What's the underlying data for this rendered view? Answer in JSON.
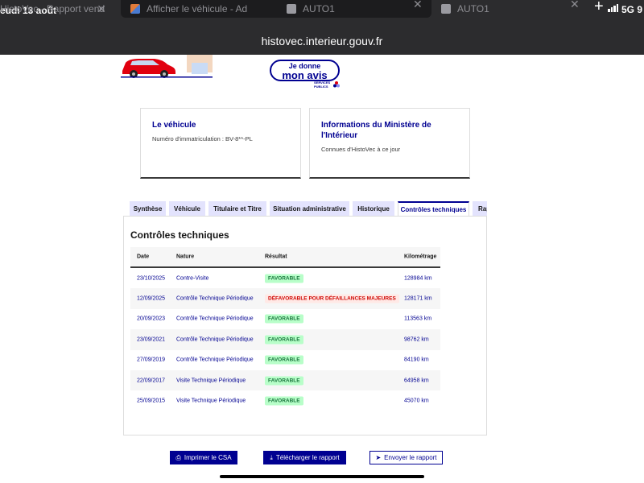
{
  "status_bar": {
    "date": "eudi 13 août",
    "network": "5G 9"
  },
  "browser": {
    "tabs": [
      {
        "title": "HistoVec - Rapport vend"
      },
      {
        "title": "Afficher le véhicule - Ad"
      },
      {
        "title": "AUTO1"
      },
      {
        "title": "AUTO1"
      }
    ],
    "url": "histovec.interieur.gouv.fr"
  },
  "header": {
    "opinion_line1": "Je donne",
    "opinion_line2": "mon avis",
    "services_line1": "SERVICES",
    "services_line2": "PUBLICS"
  },
  "cards": [
    {
      "title": "Le véhicule",
      "text": "Numéro d'immatriculation : BV-8**-PL"
    },
    {
      "title": "Informations du Ministère de l'Intérieur",
      "text": "Connues d'HistoVec à ce jour"
    }
  ],
  "tabs": [
    {
      "label": "Synthèse"
    },
    {
      "label": "Véhicule"
    },
    {
      "label": "Titulaire et Titre"
    },
    {
      "label": "Situation administrative"
    },
    {
      "label": "Historique"
    },
    {
      "label": "Contrôles techniques"
    },
    {
      "label": "Rap"
    }
  ],
  "active_tab": "Contrôles techniques",
  "section_title": "Contrôles techniques",
  "table": {
    "headers": [
      "Date",
      "Nature",
      "Résultat",
      "Kilométrage"
    ],
    "rows": [
      {
        "date": "23/10/2025",
        "nature": "Contre-Visite",
        "result": "FAVORABLE",
        "km": "128984 km"
      },
      {
        "date": "12/09/2025",
        "nature": "Contrôle Technique Périodique",
        "result": "DÉFAVORABLE POUR DÉFAILLANCES MAJEURES",
        "km": "128171 km"
      },
      {
        "date": "20/09/2023",
        "nature": "Contrôle Technique Périodique",
        "result": "FAVORABLE",
        "km": "113563 km"
      },
      {
        "date": "23/09/2021",
        "nature": "Contrôle Technique Périodique",
        "result": "FAVORABLE",
        "km": "98762 km"
      },
      {
        "date": "27/09/2019",
        "nature": "Contrôle Technique Périodique",
        "result": "FAVORABLE",
        "km": "84190 km"
      },
      {
        "date": "22/09/2017",
        "nature": "Visite Technique Périodique",
        "result": "FAVORABLE",
        "km": "64958 km"
      },
      {
        "date": "25/09/2015",
        "nature": "Visite Technique Périodique",
        "result": "FAVORABLE",
        "km": "45070 km"
      }
    ]
  },
  "actions": {
    "print": "Imprimer le CSA",
    "download": "Télécharger le rapport",
    "send": "Envoyer le rapport"
  },
  "icons": {
    "print": "printer-icon",
    "download": "download-icon",
    "send": "send-icon",
    "tab_close": "close-icon",
    "new_tab": "plus-icon"
  },
  "colors": {
    "primary": "#000091",
    "favorable_bg": "#b8fec9",
    "favorable_text": "#18753c",
    "defavorable_bg": "#ffe9e6",
    "defavorable_text": "#ce0500",
    "chrome_bg": "#2c2c2e"
  }
}
